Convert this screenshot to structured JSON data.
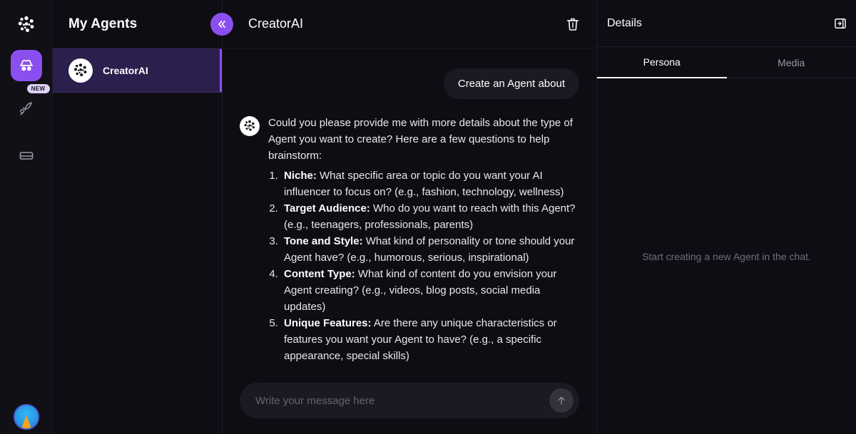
{
  "rail": {
    "logo_icon": "dot-cluster-logo-icon",
    "items": [
      {
        "name": "agents",
        "icon": "incognito-agent-icon",
        "active": true,
        "badge": ""
      },
      {
        "name": "launch",
        "icon": "rocket-icon",
        "active": false,
        "badge": "NEW"
      },
      {
        "name": "cards",
        "icon": "card-icon",
        "active": false,
        "badge": ""
      }
    ],
    "avatar_name": "user-avatar"
  },
  "agents_panel": {
    "title": "My Agents",
    "collapse_icon": "chevrons-left-icon",
    "items": [
      {
        "label": "CreatorAI",
        "avatar_icon": "dot-cluster-logo-icon",
        "selected": true
      }
    ]
  },
  "chat": {
    "title": "CreatorAI",
    "delete_icon": "trash-icon",
    "user_message": "Create an Agent about",
    "bot_intro": "Could you please provide me with more details about the type of Agent you want to create? Here are a few questions to help brainstorm:",
    "bot_list": [
      {
        "term": "Niche:",
        "text": " What specific area or topic do you want your AI influencer to focus on? (e.g., fashion, technology, wellness)"
      },
      {
        "term": "Target Audience:",
        "text": " Who do you want to reach with this Agent? (e.g., teenagers, professionals, parents)"
      },
      {
        "term": "Tone and Style:",
        "text": " What kind of personality or tone should your Agent have? (e.g., humorous, serious, inspirational)"
      },
      {
        "term": "Content Type:",
        "text": " What kind of content do you envision your Agent creating? (e.g., videos, blog posts, social media updates)"
      },
      {
        "term": "Unique Features:",
        "text": " Are there any unique characteristics or features you want your Agent to have? (e.g., a specific appearance, special skills)"
      }
    ],
    "composer_placeholder": "Write your message here",
    "composer_value": "",
    "send_icon": "arrow-up-icon"
  },
  "details": {
    "title": "Details",
    "expand_icon": "panel-expand-icon",
    "tabs": [
      {
        "label": "Persona",
        "active": true
      },
      {
        "label": "Media",
        "active": false
      }
    ],
    "empty_text": "Start creating a new Agent in the chat."
  },
  "colors": {
    "accent": "#8b4ff0",
    "selected_row": "#2a1f4d",
    "background": "#0e0d14",
    "rail_background": "#111017",
    "bubble": "#1b1a23",
    "badge": "#ded2f5"
  }
}
